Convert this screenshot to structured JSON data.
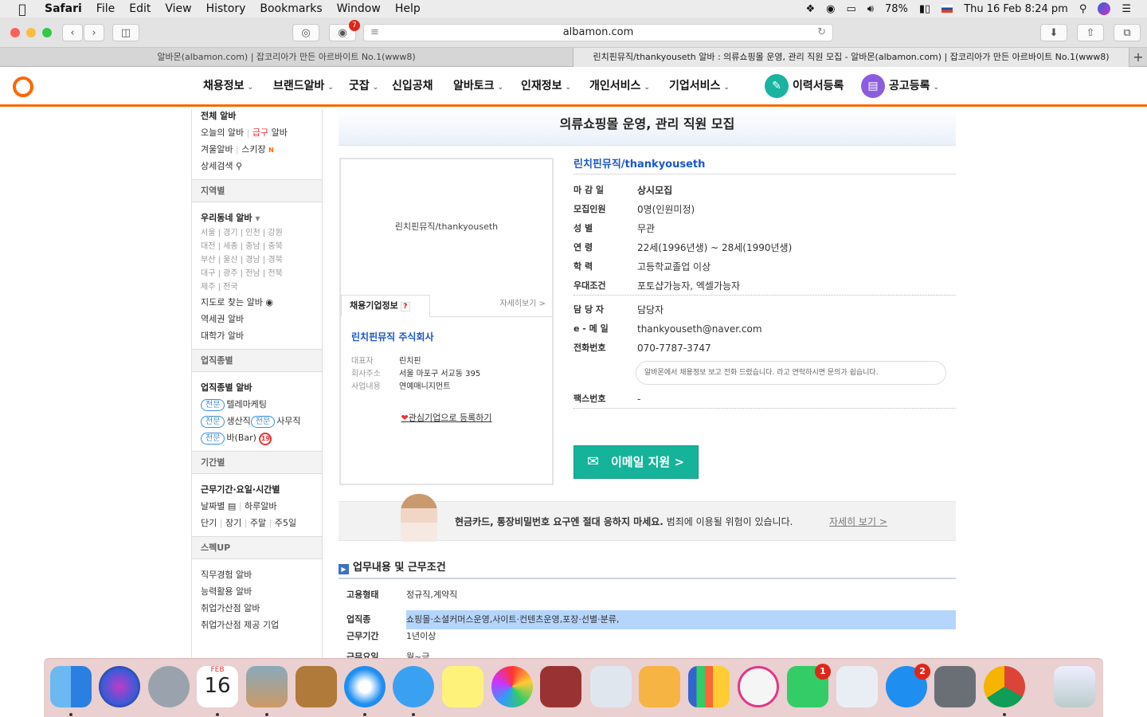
{
  "menubar": {
    "app": "Safari",
    "items": [
      "File",
      "Edit",
      "View",
      "History",
      "Bookmarks",
      "Window",
      "Help"
    ],
    "battery": "78%",
    "clock": "Thu 16 Feb  8:24 pm"
  },
  "browser": {
    "url": "albamon.com",
    "abp_badge": "7",
    "tabs": [
      "알바몬(albamon.com) | 잡코리아가 만든 아르바이트 No.1(www8)",
      "린치핀뮤직/thankyouseth 알바 : 의류쇼핑몰 운영, 관리 직원 모집 - 알바몬(albamon.com) | 잡코리아가 만든 아르바이트 No.1(www8)"
    ],
    "new_tab": "+"
  },
  "gnb": {
    "items": [
      "채용정보",
      "브랜드알바",
      "굿잡",
      "신입공채",
      "알바토크",
      "인재정보",
      "개인서비스",
      "기업서비스"
    ],
    "resume_label": "이력서등록",
    "post_label": "공고등록"
  },
  "sidebar": {
    "top_links": [
      "전체 알바",
      "오늘의 알바",
      "급구",
      "알바",
      "겨울알바",
      "스키장",
      "N",
      "상세검색"
    ],
    "section_region": "지역별",
    "my_area": "우리동네 알바",
    "regions": [
      "서울 | 경기 | 인천 | 강원",
      "대전 | 세종 | 충남 | 충북",
      "부산 | 울산 | 경남 | 경북",
      "대구 | 광주 | 전남 | 전북",
      "제주 | 전국"
    ],
    "region_links": [
      "지도로 찾는 알바",
      "역세권 알바",
      "대학가 알바"
    ],
    "section_job": "업직종별",
    "job_title": "업직종별 알바",
    "pill": "전문",
    "jobs": [
      "텔레마케팅",
      "생산직",
      "사무직",
      "바(Bar)"
    ],
    "age_badge": "19",
    "section_period": "기간별",
    "period_title": "근무기간·요일·시간별",
    "period_row1": [
      "날짜별",
      "하루알바"
    ],
    "period_row2": [
      "단기",
      "장기",
      "주말",
      "주5일"
    ],
    "section_spec": "스펙UP",
    "spec_links": [
      "직무경험 알바",
      "능력활용 알바",
      "취업가산점 알바",
      "취업가산점 제공 기업"
    ]
  },
  "job": {
    "title": "의류쇼핑몰 운영, 관리 직원 모집",
    "corp_short": "린치핀뮤직/thankyouseth",
    "card": {
      "logo_text": "린치핀뮤직/thankyouseth",
      "tab_label": "채용기업정보",
      "q": "?",
      "more": "자세히보기 >",
      "company": "린치핀뮤직 주식회사",
      "fields": [
        {
          "k": "대표자",
          "v": "린치핀"
        },
        {
          "k": "회사주소",
          "v": "서울 마포구 서교동 395"
        },
        {
          "k": "사업내용",
          "v": "연예매니지먼트"
        }
      ],
      "fav": "관심기업으로 등록하기"
    },
    "details": [
      {
        "k": "마 감 일",
        "v": "상시모집"
      },
      {
        "k": "모집인원",
        "v": "0명(인원미정)"
      },
      {
        "k": "성      별",
        "v": "무관"
      },
      {
        "k": "연      령",
        "v": "22세(1996년생) ~ 28세(1990년생)"
      },
      {
        "k": "학      력",
        "v": "고등학교졸업 이상"
      },
      {
        "k": "우대조건",
        "v": "포토샵가능자, 엑셀가능자"
      }
    ],
    "contact": [
      {
        "k": "담 당 자",
        "v": "담당자"
      },
      {
        "k": "e - 메 일",
        "v": "thankyouseth@naver.com"
      },
      {
        "k": "전화번호",
        "v": "070-7787-3747"
      }
    ],
    "phone_note": "알바몬에서 채용정보 보고 전화 드렸습니다. 라고 연락하시면 문의가 쉽습니다.",
    "fax_label": "팩스번호",
    "fax_value": "-",
    "apply_label": "이메일 지원 >",
    "warning_bold": "현금카드, 통장비밀번호 요구엔 절대 응하지 마세요.",
    "warning_rest": " 범죄에 이용될 위험이 있습니다.",
    "warning_more": "자세히 보기 >",
    "section_title": "업무내용 및 근무조건",
    "work": [
      {
        "k": "고용형태",
        "v": "정규직,계약직"
      },
      {
        "k": "업직종",
        "v": "쇼핑몰·소셜커머스운영,사이트·컨텐츠운영,포장·선별·분류,"
      },
      {
        "k": "근무기간",
        "v": "1년이상"
      },
      {
        "k": "근무요일",
        "v": "월~금"
      }
    ]
  },
  "dock": {
    "calendar_month": "FEB",
    "calendar_day": "16",
    "facetime_badge": "1",
    "appstore_badge": "2"
  },
  "colors": {
    "accent": "#ff6600",
    "link": "#1a56c9",
    "apply": "#15b39a",
    "highlight": "#b5d5fd"
  }
}
